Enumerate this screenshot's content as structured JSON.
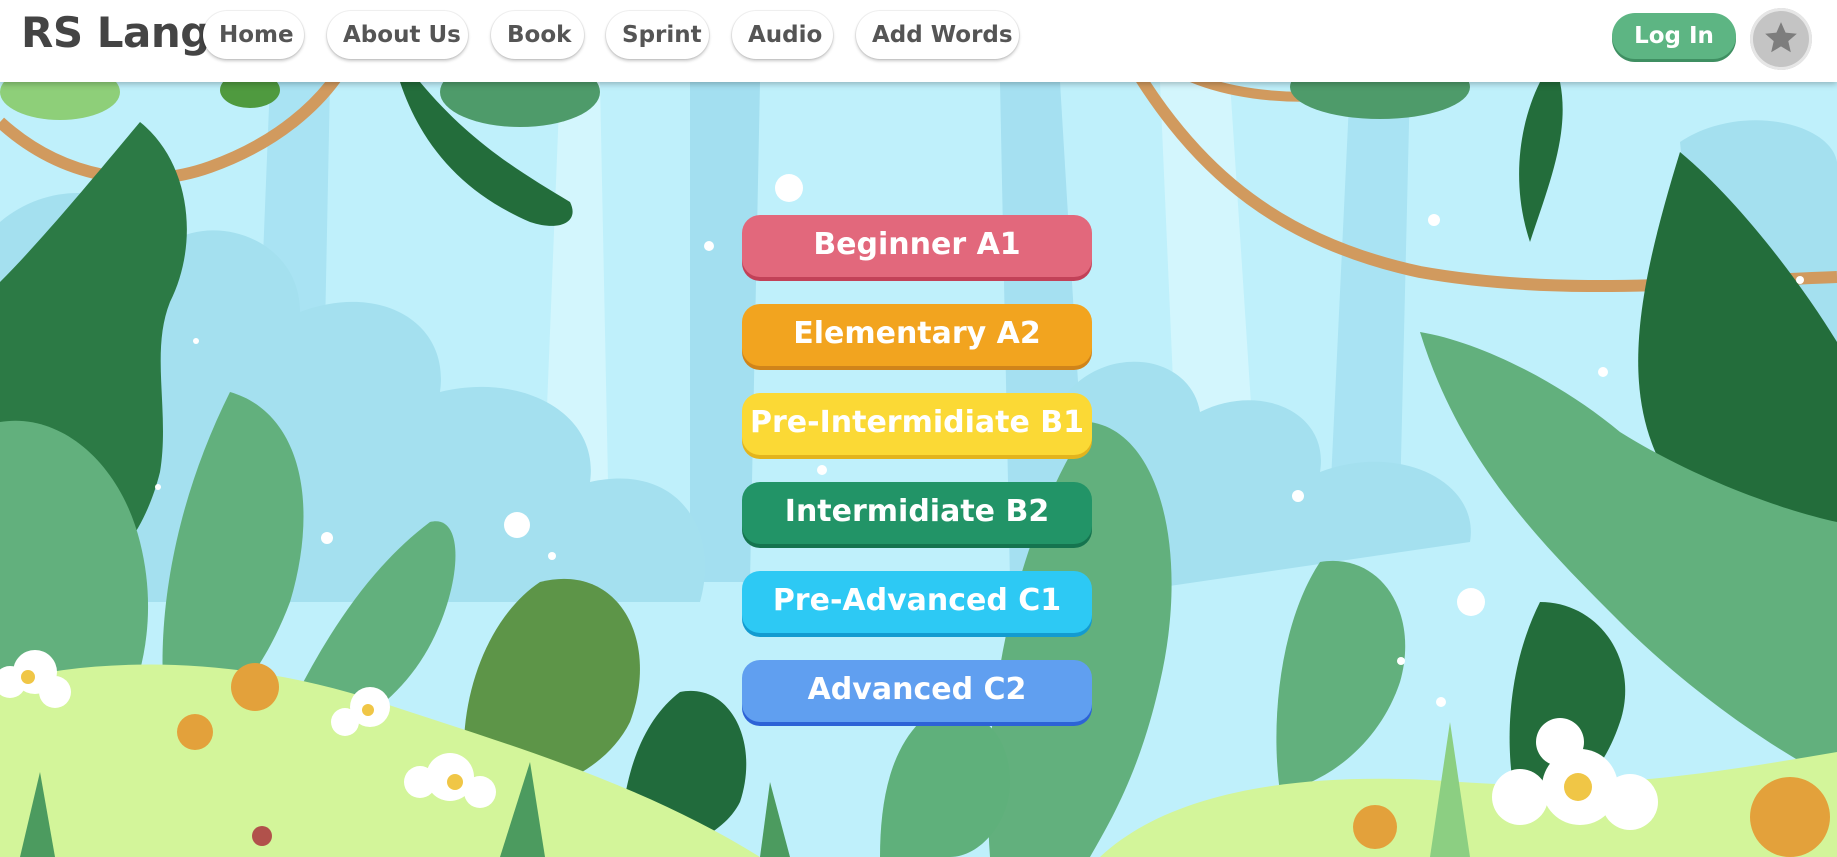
{
  "header": {
    "logo": "RS Lang",
    "nav": [
      {
        "label": "Home"
      },
      {
        "label": "About Us"
      },
      {
        "label": "Book"
      },
      {
        "label": "Sprint"
      },
      {
        "label": "Audio"
      },
      {
        "label": "Add Words"
      }
    ],
    "login_label": "Log In",
    "avatar_icon": "star-icon",
    "accent_color": "#5db583"
  },
  "levels": [
    {
      "label": "Beginner A1",
      "color": "#e2687c"
    },
    {
      "label": "Elementary A2",
      "color": "#f2a41f"
    },
    {
      "label": "Pre-Intermidiate B1",
      "color": "#fbd935"
    },
    {
      "label": "Intermidiate B2",
      "color": "#229467"
    },
    {
      "label": "Pre-Advanced C1",
      "color": "#2dc9f4"
    },
    {
      "label": "Advanced C2",
      "color": "#609ff0"
    }
  ]
}
